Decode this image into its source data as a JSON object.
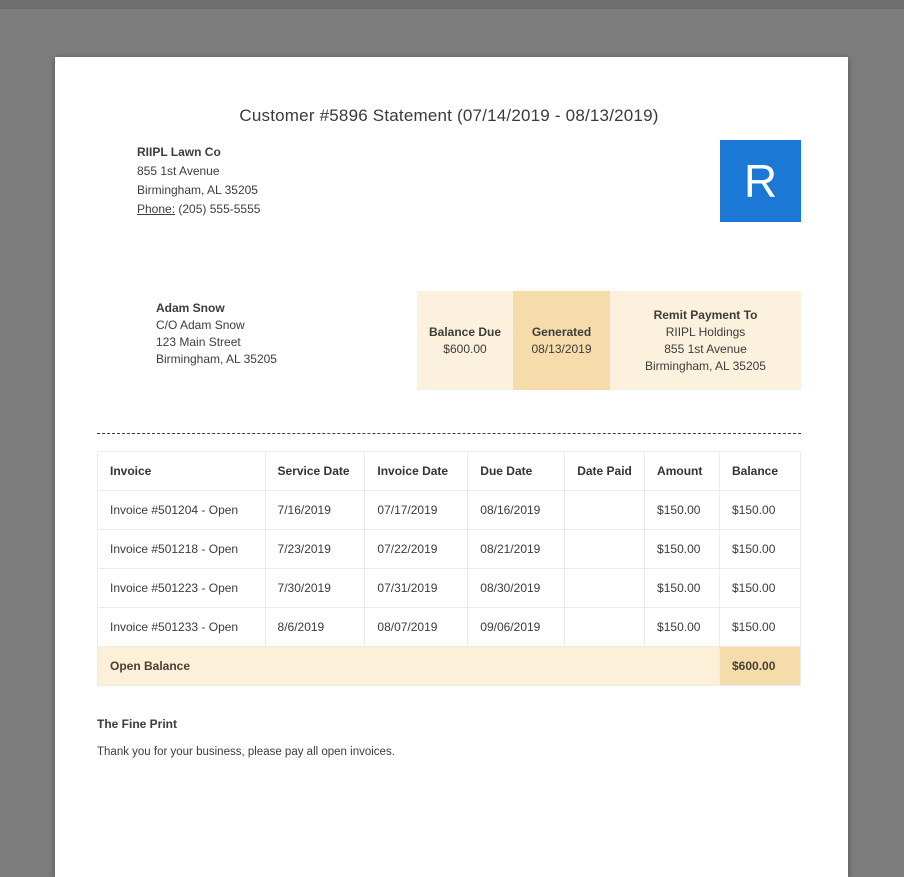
{
  "title": "Customer #5896 Statement (07/14/2019 - 08/13/2019)",
  "company": {
    "name": "RIIPL Lawn Co",
    "address1": "855 1st Avenue",
    "address2": "Birmingham, AL 35205",
    "phone_label": "Phone:",
    "phone": "(205) 555-5555",
    "logo_letter": "R"
  },
  "customer": {
    "name": "Adam Snow",
    "line1": "C/O Adam Snow",
    "line2": "123 Main Street",
    "line3": "Birmingham, AL 35205"
  },
  "summary": {
    "balance_due_label": "Balance Due",
    "balance_due_value": "$600.00",
    "generated_label": "Generated",
    "generated_value": "08/13/2019",
    "remit_label": "Remit Payment To",
    "remit_line1": "RIIPL Holdings",
    "remit_line2": "855 1st Avenue",
    "remit_line3": "Birmingham, AL 35205"
  },
  "invoice_table": {
    "headers": [
      "Invoice",
      "Service Date",
      "Invoice Date",
      "Due Date",
      "Date Paid",
      "Amount",
      "Balance"
    ],
    "rows": [
      [
        "Invoice #501204 - Open",
        "7/16/2019",
        "07/17/2019",
        "08/16/2019",
        "",
        "$150.00",
        "$150.00"
      ],
      [
        "Invoice #501218 - Open",
        "7/23/2019",
        "07/22/2019",
        "08/21/2019",
        "",
        "$150.00",
        "$150.00"
      ],
      [
        "Invoice #501223 - Open",
        "7/30/2019",
        "07/31/2019",
        "08/30/2019",
        "",
        "$150.00",
        "$150.00"
      ],
      [
        "Invoice #501233 - Open",
        "8/6/2019",
        "08/07/2019",
        "09/06/2019",
        "",
        "$150.00",
        "$150.00"
      ]
    ],
    "footer_label": "Open Balance",
    "footer_value": "$600.00"
  },
  "fine_print": {
    "heading": "The Fine Print",
    "text": "Thank you for your business, please pay all open invoices."
  },
  "colors": {
    "accent_blue": "#1b78d4",
    "summary_light": "#fcf1dd",
    "summary_dark": "#f7dcab",
    "viewer_background": "#7d7d7d"
  }
}
